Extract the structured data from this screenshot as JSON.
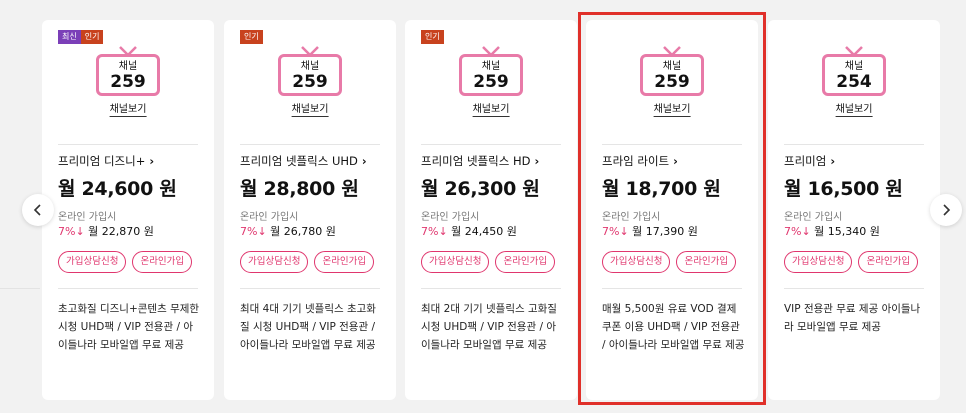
{
  "colors": {
    "accent": "#e0366e",
    "tv": "#e87aa8",
    "badge_new": "#7b3fb8",
    "badge_hot": "#c8421e",
    "highlight": "#e0302a"
  },
  "nav": {
    "prev_icon": "chevron-left-icon",
    "next_icon": "chevron-right-icon"
  },
  "cards": [
    {
      "badges": [
        "최신",
        "인기"
      ],
      "channel_label": "채널",
      "channels": "259",
      "view_label": "채널보기",
      "name": "프리미엄 디즈니+",
      "price": "월 24,600 원",
      "online_label": "온라인 가입시",
      "discount": "7%↓",
      "discount_price": "월 22,870 원",
      "consult_btn": "가입상담신청",
      "online_btn": "온라인가입",
      "desc": "초고화질 디즈니+콘텐츠 무제한 시청 UHD팩 / VIP 전용관 / 아이들나라 모바일앱 무료 제공"
    },
    {
      "badges": [
        "인기"
      ],
      "channel_label": "채널",
      "channels": "259",
      "view_label": "채널보기",
      "name": "프리미엄 넷플릭스 UHD",
      "price": "월 28,800 원",
      "online_label": "온라인 가입시",
      "discount": "7%↓",
      "discount_price": "월 26,780 원",
      "consult_btn": "가입상담신청",
      "online_btn": "온라인가입",
      "desc": "최대 4대 기기 넷플릭스 초고화질 시청 UHD팩 / VIP 전용관 / 아이들나라 모바일앱 무료 제공"
    },
    {
      "badges": [
        "인기"
      ],
      "channel_label": "채널",
      "channels": "259",
      "view_label": "채널보기",
      "name": "프리미엄 넷플릭스 HD",
      "price": "월 26,300 원",
      "online_label": "온라인 가입시",
      "discount": "7%↓",
      "discount_price": "월 24,450 원",
      "consult_btn": "가입상담신청",
      "online_btn": "온라인가입",
      "desc": "최대 2대 기기 넷플릭스 고화질 시청 UHD팩 / VIP 전용관 / 아이들나라 모바일앱 무료 제공"
    },
    {
      "badges": [],
      "channel_label": "채널",
      "channels": "259",
      "view_label": "채널보기",
      "name": "프라임 라이트",
      "price": "월 18,700 원",
      "online_label": "온라인 가입시",
      "discount": "7%↓",
      "discount_price": "월 17,390 원",
      "consult_btn": "가입상담신청",
      "online_btn": "온라인가입",
      "desc": "매월 5,500원 유료 VOD 결제 쿠폰 이용 UHD팩 / VIP 전용관 / 아이들나라 모바일앱 무료 제공"
    },
    {
      "badges": [],
      "channel_label": "채널",
      "channels": "254",
      "view_label": "채널보기",
      "name": "프리미엄",
      "price": "월 16,500 원",
      "online_label": "온라인 가입시",
      "discount": "7%↓",
      "discount_price": "월 15,340 원",
      "consult_btn": "가입상담신청",
      "online_btn": "온라인가입",
      "desc": "VIP 전용관 무료 제공 아이들나라 모바일앱 무료 제공"
    }
  ]
}
